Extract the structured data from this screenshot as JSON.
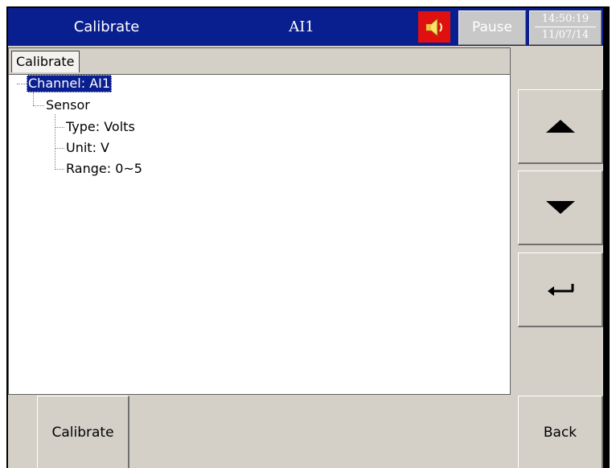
{
  "header": {
    "title": "Calibrate",
    "channel": "AI1",
    "pause_label": "Pause",
    "time": "14:50:19",
    "date": "11/07/14"
  },
  "tabs": [
    {
      "label": "Calibrate"
    }
  ],
  "tree": {
    "channel": "Channel: AI1",
    "sensor": "Sensor",
    "type": "Type: Volts",
    "unit": "Unit: V",
    "range": "Range: 0~5"
  },
  "buttons": {
    "calibrate": "Calibrate",
    "back": "Back"
  },
  "icons": {
    "speaker": "speaker-icon",
    "up": "arrow-up-icon",
    "down": "arrow-down-icon",
    "enter": "enter-icon"
  },
  "colors": {
    "header_bg": "#0a1f8f",
    "alarm": "#e01010",
    "selection": "#0a1f8f"
  }
}
